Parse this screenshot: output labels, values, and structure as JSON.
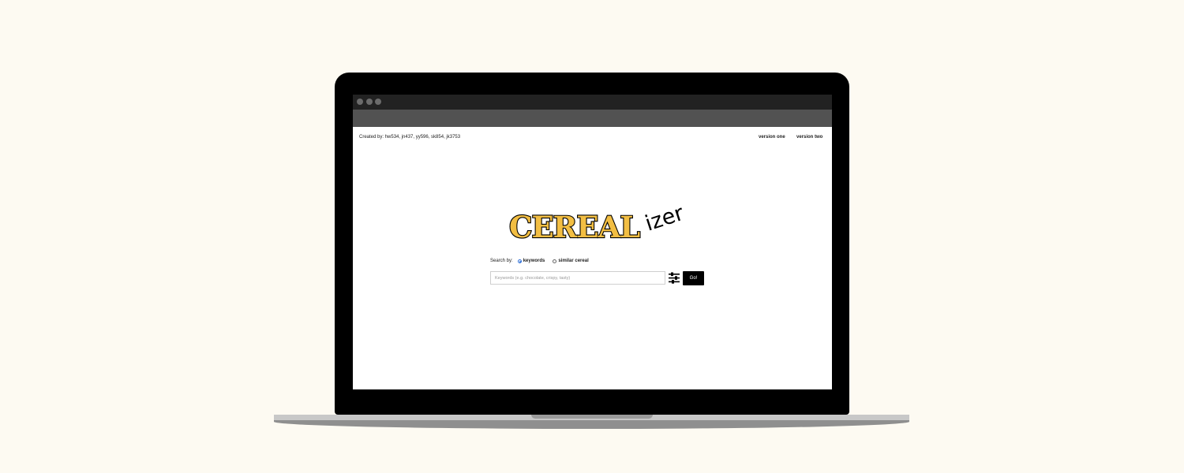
{
  "header": {
    "credits": "Created by: hw534, jn437, yy596, sk854, jk3753",
    "nav": [
      {
        "label": "version one"
      },
      {
        "label": "version two"
      }
    ]
  },
  "logo": {
    "main": "CEREAL",
    "suffix": "izer",
    "color": "#f2be43"
  },
  "search": {
    "by_label": "Search by:",
    "options": [
      {
        "label": "keywords",
        "selected": true
      },
      {
        "label": "similar cereal",
        "selected": false
      }
    ],
    "placeholder": "Keywords (e.g. chocolate, crispy, tasty)",
    "go_label": "Go!"
  },
  "icons": {
    "filter": "sliders-icon"
  }
}
